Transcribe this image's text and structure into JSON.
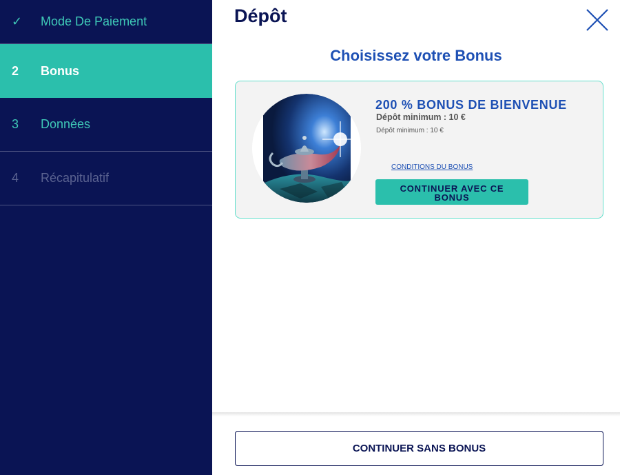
{
  "sidebar": {
    "steps": [
      {
        "marker": "✓",
        "label": "Mode De Paiement",
        "state": "completed"
      },
      {
        "marker": "2",
        "label": "Bonus",
        "state": "active"
      },
      {
        "marker": "3",
        "label": "Données",
        "state": "upcoming"
      },
      {
        "marker": "4",
        "label": "Récapitulatif",
        "state": "disabled"
      }
    ]
  },
  "header": {
    "title": "Dépôt",
    "close_icon": "close-icon"
  },
  "main": {
    "subtitle": "Choisissez votre Bonus",
    "bonus_card": {
      "image_icon": "magic-lamp-image",
      "title": "200 % BONUS DE BIENVENUE",
      "min_deposit_bold": "Dépôt minimum : 10 €",
      "min_deposit_small": "Dépôt minimum : 10 €",
      "conditions_link": "CONDITIONS DU BONUS",
      "continue_button": "CONTINUER AVEC CE BONUS"
    },
    "no_bonus_button": "CONTINUER SANS BONUS"
  },
  "colors": {
    "sidebar_bg": "#0a1454",
    "accent_teal": "#2bbfac",
    "brand_blue": "#1e50b4",
    "card_border": "#63dfcc"
  }
}
